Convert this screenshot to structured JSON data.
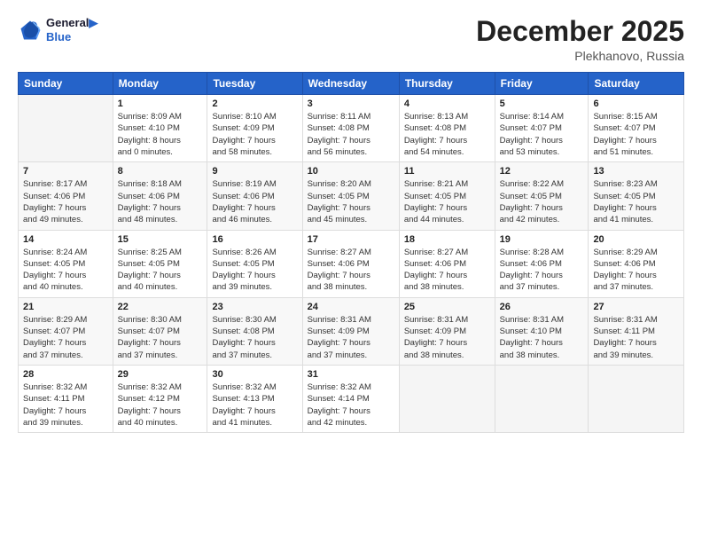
{
  "header": {
    "logo_line1": "General",
    "logo_line2": "Blue",
    "month": "December 2025",
    "location": "Plekhanovo, Russia"
  },
  "days_of_week": [
    "Sunday",
    "Monday",
    "Tuesday",
    "Wednesday",
    "Thursday",
    "Friday",
    "Saturday"
  ],
  "weeks": [
    [
      {
        "day": "",
        "info": ""
      },
      {
        "day": "1",
        "info": "Sunrise: 8:09 AM\nSunset: 4:10 PM\nDaylight: 8 hours\nand 0 minutes."
      },
      {
        "day": "2",
        "info": "Sunrise: 8:10 AM\nSunset: 4:09 PM\nDaylight: 7 hours\nand 58 minutes."
      },
      {
        "day": "3",
        "info": "Sunrise: 8:11 AM\nSunset: 4:08 PM\nDaylight: 7 hours\nand 56 minutes."
      },
      {
        "day": "4",
        "info": "Sunrise: 8:13 AM\nSunset: 4:08 PM\nDaylight: 7 hours\nand 54 minutes."
      },
      {
        "day": "5",
        "info": "Sunrise: 8:14 AM\nSunset: 4:07 PM\nDaylight: 7 hours\nand 53 minutes."
      },
      {
        "day": "6",
        "info": "Sunrise: 8:15 AM\nSunset: 4:07 PM\nDaylight: 7 hours\nand 51 minutes."
      }
    ],
    [
      {
        "day": "7",
        "info": "Sunrise: 8:17 AM\nSunset: 4:06 PM\nDaylight: 7 hours\nand 49 minutes."
      },
      {
        "day": "8",
        "info": "Sunrise: 8:18 AM\nSunset: 4:06 PM\nDaylight: 7 hours\nand 48 minutes."
      },
      {
        "day": "9",
        "info": "Sunrise: 8:19 AM\nSunset: 4:06 PM\nDaylight: 7 hours\nand 46 minutes."
      },
      {
        "day": "10",
        "info": "Sunrise: 8:20 AM\nSunset: 4:05 PM\nDaylight: 7 hours\nand 45 minutes."
      },
      {
        "day": "11",
        "info": "Sunrise: 8:21 AM\nSunset: 4:05 PM\nDaylight: 7 hours\nand 44 minutes."
      },
      {
        "day": "12",
        "info": "Sunrise: 8:22 AM\nSunset: 4:05 PM\nDaylight: 7 hours\nand 42 minutes."
      },
      {
        "day": "13",
        "info": "Sunrise: 8:23 AM\nSunset: 4:05 PM\nDaylight: 7 hours\nand 41 minutes."
      }
    ],
    [
      {
        "day": "14",
        "info": "Sunrise: 8:24 AM\nSunset: 4:05 PM\nDaylight: 7 hours\nand 40 minutes."
      },
      {
        "day": "15",
        "info": "Sunrise: 8:25 AM\nSunset: 4:05 PM\nDaylight: 7 hours\nand 40 minutes."
      },
      {
        "day": "16",
        "info": "Sunrise: 8:26 AM\nSunset: 4:05 PM\nDaylight: 7 hours\nand 39 minutes."
      },
      {
        "day": "17",
        "info": "Sunrise: 8:27 AM\nSunset: 4:06 PM\nDaylight: 7 hours\nand 38 minutes."
      },
      {
        "day": "18",
        "info": "Sunrise: 8:27 AM\nSunset: 4:06 PM\nDaylight: 7 hours\nand 38 minutes."
      },
      {
        "day": "19",
        "info": "Sunrise: 8:28 AM\nSunset: 4:06 PM\nDaylight: 7 hours\nand 37 minutes."
      },
      {
        "day": "20",
        "info": "Sunrise: 8:29 AM\nSunset: 4:06 PM\nDaylight: 7 hours\nand 37 minutes."
      }
    ],
    [
      {
        "day": "21",
        "info": "Sunrise: 8:29 AM\nSunset: 4:07 PM\nDaylight: 7 hours\nand 37 minutes."
      },
      {
        "day": "22",
        "info": "Sunrise: 8:30 AM\nSunset: 4:07 PM\nDaylight: 7 hours\nand 37 minutes."
      },
      {
        "day": "23",
        "info": "Sunrise: 8:30 AM\nSunset: 4:08 PM\nDaylight: 7 hours\nand 37 minutes."
      },
      {
        "day": "24",
        "info": "Sunrise: 8:31 AM\nSunset: 4:09 PM\nDaylight: 7 hours\nand 37 minutes."
      },
      {
        "day": "25",
        "info": "Sunrise: 8:31 AM\nSunset: 4:09 PM\nDaylight: 7 hours\nand 38 minutes."
      },
      {
        "day": "26",
        "info": "Sunrise: 8:31 AM\nSunset: 4:10 PM\nDaylight: 7 hours\nand 38 minutes."
      },
      {
        "day": "27",
        "info": "Sunrise: 8:31 AM\nSunset: 4:11 PM\nDaylight: 7 hours\nand 39 minutes."
      }
    ],
    [
      {
        "day": "28",
        "info": "Sunrise: 8:32 AM\nSunset: 4:11 PM\nDaylight: 7 hours\nand 39 minutes."
      },
      {
        "day": "29",
        "info": "Sunrise: 8:32 AM\nSunset: 4:12 PM\nDaylight: 7 hours\nand 40 minutes."
      },
      {
        "day": "30",
        "info": "Sunrise: 8:32 AM\nSunset: 4:13 PM\nDaylight: 7 hours\nand 41 minutes."
      },
      {
        "day": "31",
        "info": "Sunrise: 8:32 AM\nSunset: 4:14 PM\nDaylight: 7 hours\nand 42 minutes."
      },
      {
        "day": "",
        "info": ""
      },
      {
        "day": "",
        "info": ""
      },
      {
        "day": "",
        "info": ""
      }
    ]
  ]
}
